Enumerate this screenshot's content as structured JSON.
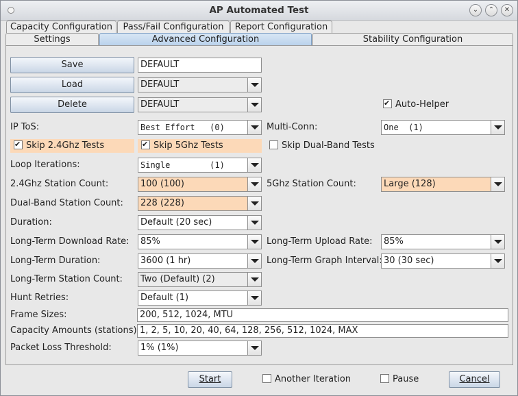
{
  "window": {
    "title": "AP Automated Test",
    "controls": [
      "minimize",
      "maximize",
      "close"
    ]
  },
  "tabs": {
    "row1": [
      {
        "label": "Capacity Configuration"
      },
      {
        "label": "Pass/Fail Configuration"
      },
      {
        "label": "Report Configuration"
      }
    ],
    "row2": [
      {
        "label": "Settings"
      },
      {
        "label": "Advanced Configuration",
        "selected": true
      },
      {
        "label": "Stability Configuration"
      }
    ]
  },
  "config": {
    "save_label": "Save",
    "save_value": "DEFAULT",
    "load_label": "Load",
    "load_value": "DEFAULT",
    "delete_label": "Delete",
    "delete_value": "DEFAULT",
    "auto_helper": {
      "label": "Auto-Helper",
      "checked": true
    }
  },
  "form": {
    "ip_tos": {
      "label": "IP ToS:",
      "value": "Best Effort   (0)"
    },
    "multi_conn": {
      "label": "Multi-Conn:",
      "value": "One  (1)"
    },
    "skip_24": {
      "label": "Skip 2.4Ghz Tests",
      "checked": true
    },
    "skip_5": {
      "label": "Skip 5Ghz Tests",
      "checked": true
    },
    "skip_dual": {
      "label": "Skip Dual-Band Tests",
      "checked": false
    },
    "loop_iterations": {
      "label": "Loop Iterations:",
      "value": "Single        (1)"
    },
    "station_24": {
      "label": "2.4Ghz Station Count:",
      "value": "100 (100)"
    },
    "station_5": {
      "label": "5Ghz Station Count:",
      "value": "Large (128)"
    },
    "station_dual": {
      "label": "Dual-Band Station Count:",
      "value": "228 (228)"
    },
    "duration": {
      "label": "Duration:",
      "value": "Default (20 sec)"
    },
    "lt_download": {
      "label": "Long-Term Download Rate:",
      "value": "85%"
    },
    "lt_upload": {
      "label": "Long-Term Upload Rate:",
      "value": "85%"
    },
    "lt_duration": {
      "label": "Long-Term Duration:",
      "value": "3600 (1 hr)"
    },
    "lt_graph_interval": {
      "label": "Long-Term Graph Interval:",
      "value": "30 (30 sec)"
    },
    "lt_station_count": {
      "label": "Long-Term Station Count:",
      "value": "Two (Default) (2)"
    },
    "hunt_retries": {
      "label": "Hunt Retries:",
      "value": "Default (1)"
    },
    "frame_sizes": {
      "label": "Frame Sizes:",
      "value": "200, 512, 1024, MTU"
    },
    "capacity_amounts": {
      "label": "Capacity Amounts (stations):",
      "value": "1, 2, 5, 10, 20, 40, 64, 128, 256, 512, 1024, MAX"
    },
    "packet_loss": {
      "label": "Packet Loss Threshold:",
      "value": "1% (1%)"
    }
  },
  "footer": {
    "start_label": "Start",
    "another_iteration": {
      "label": "Another Iteration",
      "checked": false
    },
    "pause": {
      "label": "Pause",
      "checked": false
    },
    "cancel_label": "Cancel"
  },
  "colors": {
    "highlight": "#fcd9b8",
    "selected_tab": "#b9d2ec"
  }
}
